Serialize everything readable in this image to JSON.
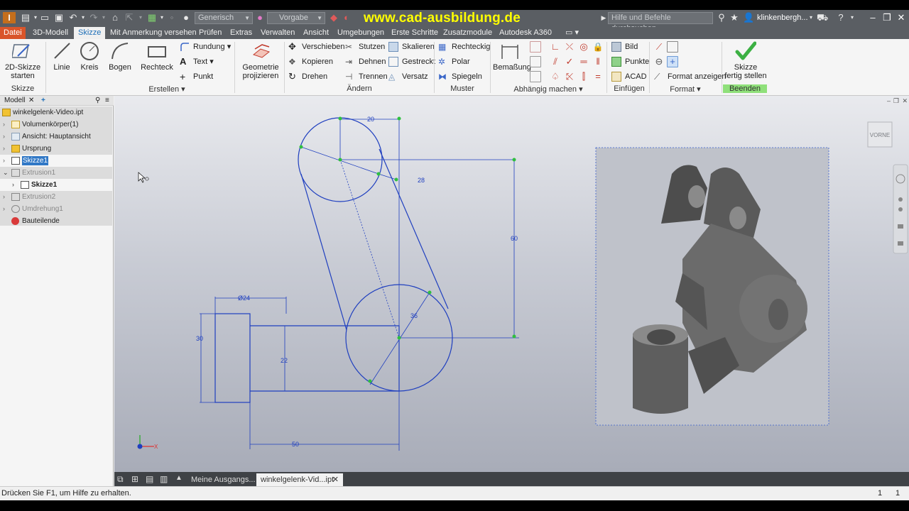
{
  "title_bar": {
    "style_combo": "Generisch",
    "appearance_combo": "Vorgabe",
    "watermark": "www.cad-ausbildung.de",
    "search_placeholder": "Hilfe und Befehle durchsuchen...",
    "user": "klinkenbergh..."
  },
  "tabs": [
    "Datei",
    "3D-Modell",
    "Skizze",
    "Mit Anmerkung versehen",
    "Prüfen",
    "Extras",
    "Verwalten",
    "Ansicht",
    "Umgebungen",
    "Erste Schritte",
    "Zusatzmodule",
    "Autodesk A360"
  ],
  "ribbon": {
    "skizze_start": "2D-Skizze",
    "skizze_start2": "starten",
    "grp_skizze": "Skizze",
    "linie": "Linie",
    "kreis": "Kreis",
    "bogen": "Bogen",
    "rechteck": "Rechteck",
    "rundung": "Rundung",
    "text": "Text",
    "punkt": "Punkt",
    "grp_erstellen": "Erstellen",
    "geometrie1": "Geometrie",
    "geometrie2": "projizieren",
    "verschieben": "Verschieben",
    "kopieren": "Kopieren",
    "drehen": "Drehen",
    "stutzen": "Stutzen",
    "dehnen": "Dehnen",
    "trennen": "Trennen",
    "skalieren": "Skalieren",
    "gestreckt": "Gestreckt",
    "versatz": "Versatz",
    "grp_aendern": "Ändern",
    "rechteckig": "Rechteckig",
    "polar": "Polar",
    "spiegeln": "Spiegeln",
    "grp_muster": "Muster",
    "bemassung": "Bemaßung",
    "grp_abhaengig": "Abhängig machen",
    "bild": "Bild",
    "punkte": "Punkte",
    "acad": "ACAD",
    "grp_einfuegen": "Einfügen",
    "format_anzeigen": "Format anzeigen",
    "grp_format": "Format",
    "fertig1": "Skizze",
    "fertig2": "fertig stellen",
    "grp_beenden": "Beenden"
  },
  "browser": {
    "tab": "Modell",
    "items": [
      {
        "label": "winkelgelenk-Video.ipt"
      },
      {
        "label": "Volumenkörper(1)"
      },
      {
        "label": "Ansicht: Hauptansicht"
      },
      {
        "label": "Ursprung"
      },
      {
        "label": "Skizze1"
      },
      {
        "label": "Extrusion1"
      },
      {
        "label": "Skizze1"
      },
      {
        "label": "Extrusion2"
      },
      {
        "label": "Umdrehung1"
      },
      {
        "label": "Bauteilende"
      }
    ]
  },
  "viewcube": {
    "label": "VORNE"
  },
  "dimensions": {
    "d20": "20",
    "d28": "28",
    "d60": "60",
    "d36": "36",
    "d24": "Ø24",
    "d30": "30",
    "d22": "22",
    "d50": "50"
  },
  "axes": {
    "x": "X"
  },
  "doc_tabs": [
    "Meine Ausgangs...",
    "winkelgelenk-Vid...ipt"
  ],
  "status": {
    "hint": "Drücken Sie F1, um Hilfe zu erhalten.",
    "n1": "1",
    "n2": "1"
  },
  "colors": {
    "accent_orange": "#d9552a",
    "sketch_blue": "#1f3fbf",
    "title_bg": "#5a5e63",
    "finish_green": "#3cb043"
  }
}
